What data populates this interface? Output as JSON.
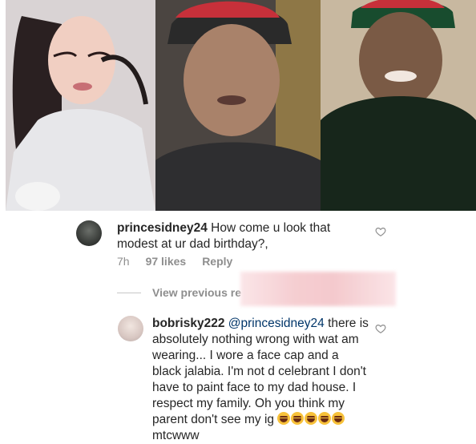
{
  "photos": [
    {
      "label": "photo-left"
    },
    {
      "label": "photo-middle"
    },
    {
      "label": "photo-right"
    }
  ],
  "comment1": {
    "username": "princesidney24",
    "text": "How come u look that modest at ur dad birthday?,",
    "time": "7h",
    "likes": "97 likes",
    "reply": "Reply"
  },
  "view_previous": {
    "label": "View previous re"
  },
  "comment2": {
    "username": "bobrisky222",
    "mention": "@princesidney24",
    "text": "there is absolutely nothing wrong with wat am wearing... I wore a face cap and a black jalabia. I'm not d celebrant I don't have to paint face to my dad house. I respect my family. Oh you think my parent don't see my ig",
    "suffix": "mtcwww",
    "emoji_count": 5,
    "emoji_name": "face-with-tears-of-joy"
  },
  "icons": {
    "like": "heart-outline-icon"
  },
  "colors": {
    "text": "#262626",
    "meta": "#8e8e8e",
    "mention": "#003569",
    "emoji": "#f7c13a"
  }
}
